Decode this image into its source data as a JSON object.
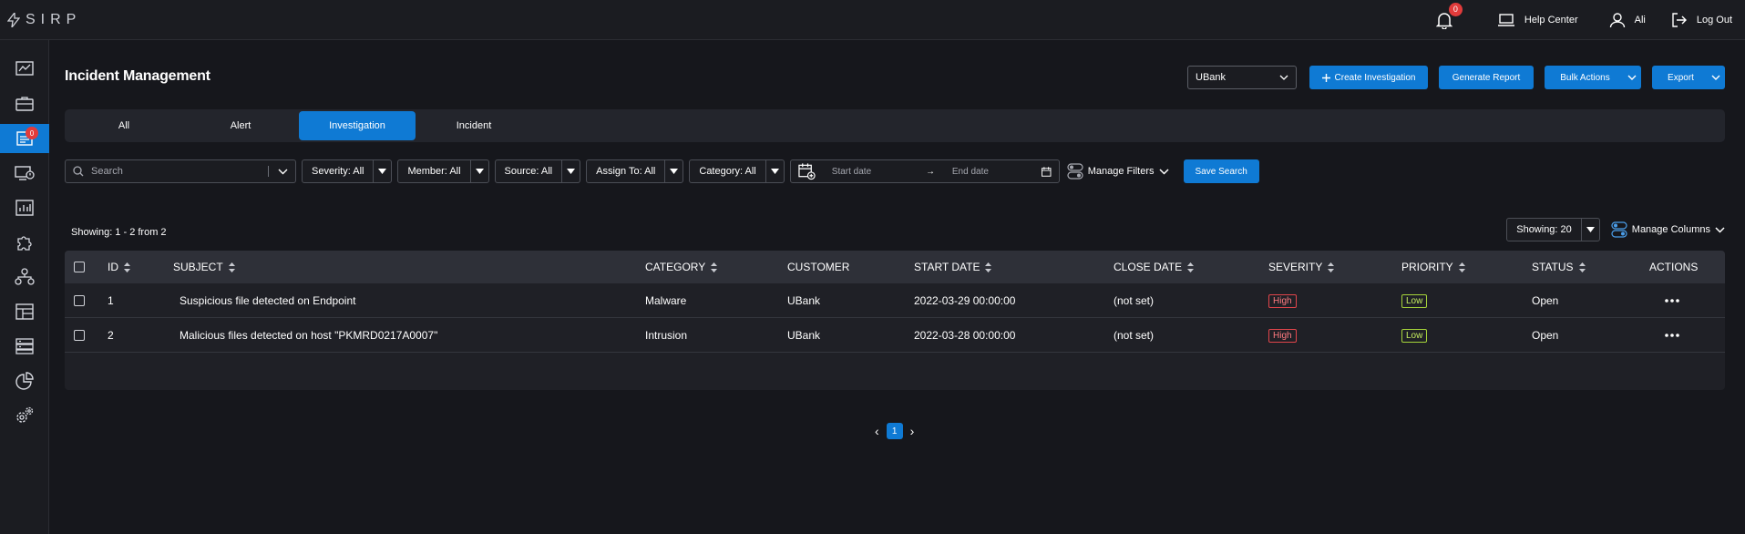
{
  "app": {
    "logo_text": "SIRP"
  },
  "topbar": {
    "notifications_count": "0",
    "help_label": "Help Center",
    "user_label": "Ali",
    "logout_label": "Log Out"
  },
  "sidebar": {
    "active_badge": "0"
  },
  "page": {
    "title": "Incident Management"
  },
  "header_actions": {
    "org_select": "UBank",
    "create_label": "Create Investigation",
    "generate_label": "Generate Report",
    "bulk_label": "Bulk Actions",
    "export_label": "Export"
  },
  "tabs": [
    {
      "label": "All"
    },
    {
      "label": "Alert"
    },
    {
      "label": "Investigation"
    },
    {
      "label": "Incident"
    }
  ],
  "filters": {
    "search_placeholder": "Search",
    "severity": "Severity: All",
    "member": "Member: All",
    "source": "Source: All",
    "assign": "Assign To: All",
    "category": "Category: All",
    "start_date": "Start date",
    "arrow": "→",
    "end_date": "End date",
    "manage_filters": "Manage Filters",
    "save_search": "Save Search"
  },
  "listing": {
    "showing_text": "Showing: 1 - 2 from 2",
    "page_size": "Showing: 20",
    "manage_columns": "Manage Columns"
  },
  "table": {
    "headers": {
      "id": "ID",
      "subject": "SUBJECT",
      "category": "CATEGORY",
      "customer": "CUSTOMER",
      "start_date": "START DATE",
      "close_date": "CLOSE DATE",
      "severity": "SEVERITY",
      "priority": "PRIORITY",
      "status": "STATUS",
      "actions": "ACTIONS"
    },
    "rows": [
      {
        "id": "1",
        "subject": "Suspicious file detected on Endpoint",
        "category": "Malware",
        "customer": "UBank",
        "start_date": "2022-03-29 00:00:00",
        "close_date": "(not set)",
        "severity": "High",
        "priority": "Low",
        "status": "Open"
      },
      {
        "id": "2",
        "subject": "Malicious files detected on host \"PKMRD0217A0007\"",
        "category": "Intrusion",
        "customer": "UBank",
        "start_date": "2022-03-28 00:00:00",
        "close_date": "(not set)",
        "severity": "High",
        "priority": "Low",
        "status": "Open"
      }
    ]
  },
  "pagination": {
    "current": "1",
    "prev": "‹",
    "next": "›"
  },
  "colors": {
    "accent": "#0f7ad4",
    "danger": "#e2454b",
    "low": "#a6d43a"
  }
}
